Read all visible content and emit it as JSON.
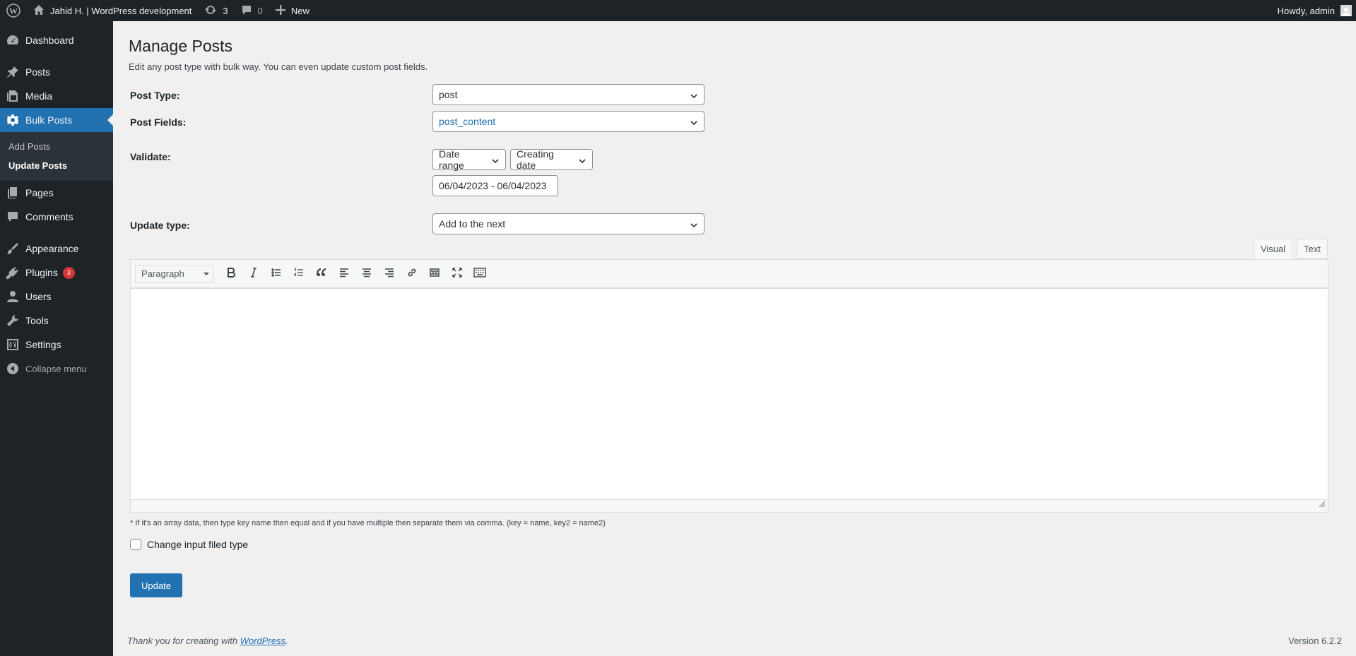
{
  "admin_bar": {
    "site_name": "Jahid H. | WordPress development",
    "updates_count": "3",
    "comments_count": "0",
    "new_label": "New",
    "howdy": "Howdy, admin"
  },
  "sidebar": {
    "items": [
      {
        "label": "Dashboard",
        "icon": "dashboard-icon"
      },
      {
        "label": "Posts",
        "icon": "pin-icon"
      },
      {
        "label": "Media",
        "icon": "media-icon"
      },
      {
        "label": "Bulk Posts",
        "icon": "gear-icon",
        "current": true
      },
      {
        "label": "Pages",
        "icon": "pages-icon"
      },
      {
        "label": "Comments",
        "icon": "comment-icon"
      },
      {
        "label": "Appearance",
        "icon": "brush-icon"
      },
      {
        "label": "Plugins",
        "icon": "plugin-icon",
        "badge": "3"
      },
      {
        "label": "Users",
        "icon": "user-icon"
      },
      {
        "label": "Tools",
        "icon": "wrench-icon"
      },
      {
        "label": "Settings",
        "icon": "settings-icon"
      }
    ],
    "submenu": [
      "Add Posts",
      "Update Posts"
    ],
    "collapse_label": "Collapse menu"
  },
  "page": {
    "title": "Manage Posts",
    "description": "Edit any post type with bulk way. You can even update custom post fields."
  },
  "form": {
    "post_type_label": "Post Type:",
    "post_type_value": "post",
    "post_fields_label": "Post Fields:",
    "post_fields_value": "post_content",
    "validate_label": "Validate:",
    "validate_mode": "Date range",
    "validate_by": "Creating date",
    "date_range": "06/04/2023 - 06/04/2023",
    "update_type_label": "Update type:",
    "update_type_value": "Add to the next"
  },
  "editor": {
    "tab_visual": "Visual",
    "tab_text": "Text",
    "format_value": "Paragraph",
    "note": "* If it's an array data, then type key name then equal and if you have multiple then separate them via comma. (key = name, key2 = name2)"
  },
  "checkbox_label": "Change input filed type",
  "update_button": "Update",
  "footer": {
    "thanks_prefix": "Thank you for creating with ",
    "wordpress_link": "WordPress",
    "thanks_suffix": ".",
    "version": "Version 6.2.2"
  },
  "colors": {
    "admin_dark": "#1d2327",
    "accent": "#2271b1",
    "background": "#f0f0f1",
    "badge": "#d63638"
  }
}
